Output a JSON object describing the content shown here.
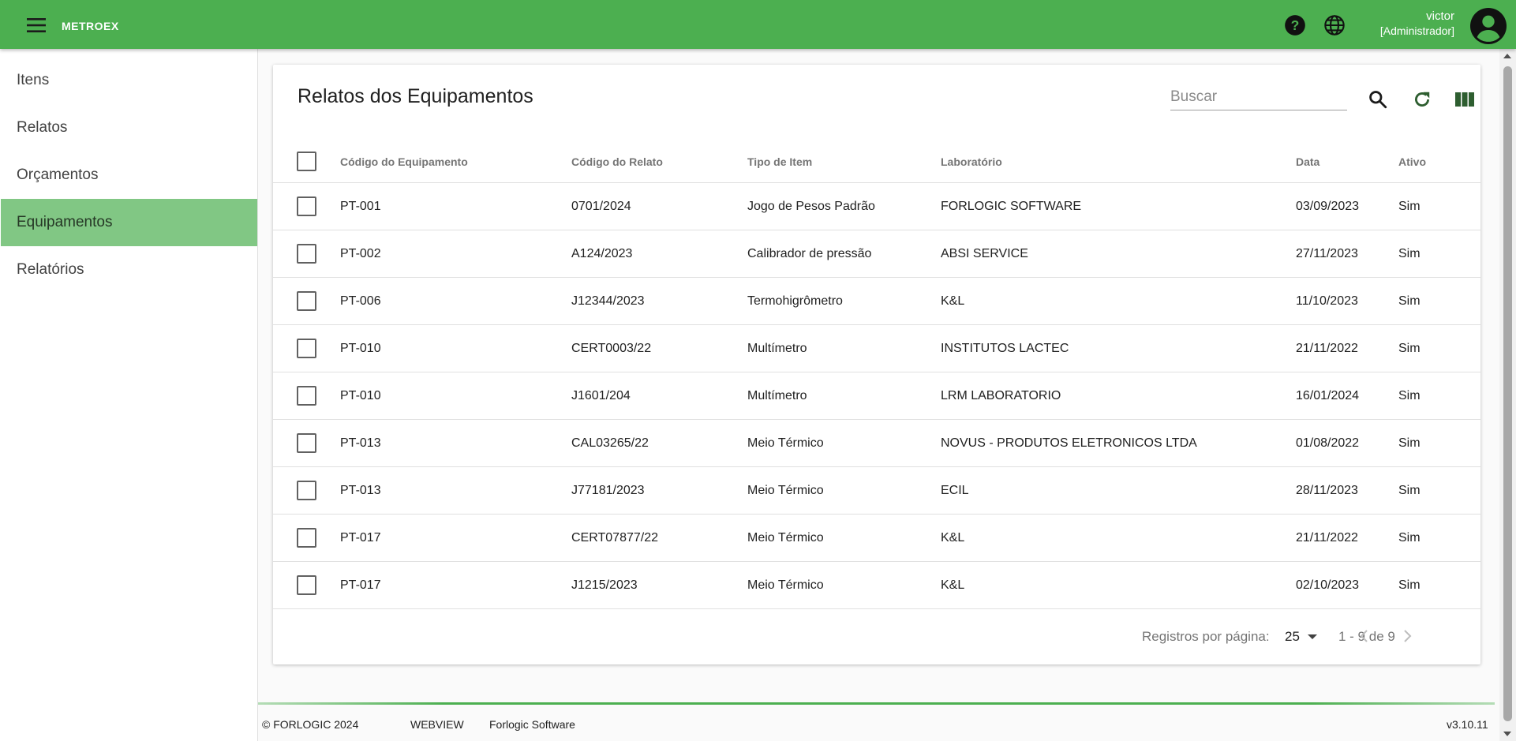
{
  "app": {
    "logo": "METROEX"
  },
  "header": {
    "icons": [
      "menu-icon",
      "help-icon",
      "globe-icon",
      "account-circle-icon"
    ],
    "user_name": "victor",
    "user_role": "[Administrador]"
  },
  "sidebar": {
    "items": [
      {
        "label": "Itens",
        "active": false
      },
      {
        "label": "Relatos",
        "active": false
      },
      {
        "label": "Orçamentos",
        "active": false
      },
      {
        "label": "Equipamentos",
        "active": true
      },
      {
        "label": "Relatórios",
        "active": false
      }
    ]
  },
  "main": {
    "title": "Relatos dos Equipamentos",
    "search_placeholder": "Buscar",
    "search_value": "",
    "toolbar_icons": [
      "search-icon",
      "refresh-icon",
      "columns-icon"
    ]
  },
  "table": {
    "headers": [
      "Código do Equipamento",
      "Código do Relato",
      "Tipo de Item",
      "Laboratório",
      "Data",
      "Ativo"
    ],
    "rows": [
      [
        "PT-001",
        "0701/2024",
        "Jogo de Pesos Padrão",
        "FORLOGIC SOFTWARE",
        "03/09/2023",
        "Sim"
      ],
      [
        "PT-002",
        "A124/2023",
        "Calibrador de pressão",
        "ABSI SERVICE",
        "27/11/2023",
        "Sim"
      ],
      [
        "PT-006",
        "J12344/2023",
        "Termohigrômetro",
        "K&L",
        "11/10/2023",
        "Sim"
      ],
      [
        "PT-010",
        "CERT0003/22",
        "Multímetro",
        "INSTITUTOS LACTEC",
        "21/11/2022",
        "Sim"
      ],
      [
        "PT-010",
        "J1601/204",
        "Multímetro",
        "LRM LABORATORIO",
        "16/01/2024",
        "Sim"
      ],
      [
        "PT-013",
        "CAL03265/22",
        "Meio Térmico",
        "NOVUS - PRODUTOS ELETRONICOS LTDA",
        "01/08/2022",
        "Sim"
      ],
      [
        "PT-013",
        "J77181/2023",
        "Meio Térmico",
        "ECIL",
        "28/11/2023",
        "Sim"
      ],
      [
        "PT-017",
        "CERT07877/22",
        "Meio Térmico",
        "K&L",
        "21/11/2022",
        "Sim"
      ],
      [
        "PT-017",
        "J1215/2023",
        "Meio Térmico",
        "K&L",
        "02/10/2023",
        "Sim"
      ]
    ]
  },
  "pagination": {
    "label": "Registros por página:",
    "per_page": "25",
    "range": "1 - 9 de 9"
  },
  "footer": {
    "copyright": "© FORLOGIC 2024",
    "webview": "WEBVIEW",
    "company": "Forlogic Software",
    "version": "v3.10.11"
  },
  "colors": {
    "primary": "#4caf50",
    "active_nav": "#81c784"
  }
}
